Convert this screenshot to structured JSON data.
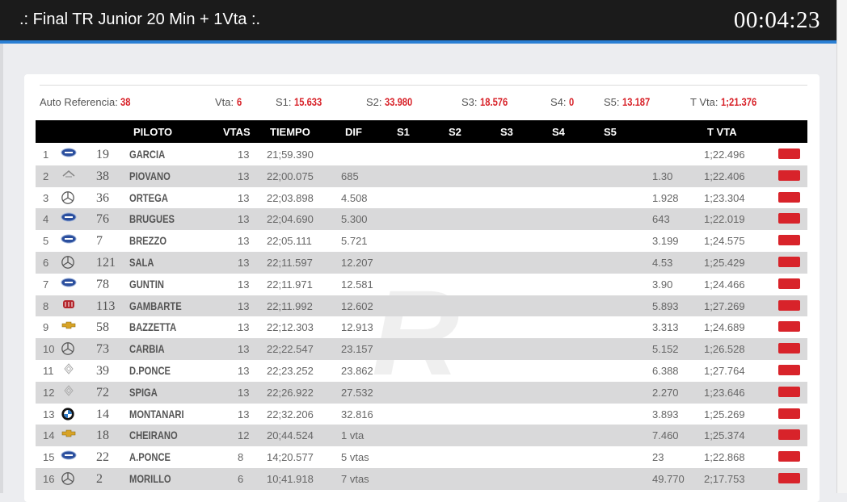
{
  "header": {
    "title": ".: Final TR Junior 20 Min + 1Vta :.",
    "clock": "00:04:23"
  },
  "refs": {
    "auto_label": "Auto Referencia:",
    "auto_value": "38",
    "vta_label": "Vta:",
    "vta_value": "6",
    "s1_label": "S1:",
    "s1_value": "15.633",
    "s2_label": "S2:",
    "s2_value": "33.980",
    "s3_label": "S3:",
    "s3_value": "18.576",
    "s4_label": "S4:",
    "s4_value": "0",
    "s5_label": "S5:",
    "s5_value": "13.187",
    "tvta_label": "T Vta:",
    "tvta_value": "1;21.376"
  },
  "table": {
    "headers": {
      "piloto": "PILOTO",
      "vtas": "VTAS",
      "tiempo": "TIEMPO",
      "dif": "DIF",
      "s1": "S1",
      "s2": "S2",
      "s3": "S3",
      "s4": "S4",
      "s5": "S5",
      "tvta": "T VTA"
    },
    "rows": [
      {
        "pos": "1",
        "brand": "ford",
        "num": "19",
        "name": "GARCIA",
        "vtas": "13",
        "tiempo": "21;59.390",
        "dif": "",
        "s5": "",
        "tvta": "1;22.496"
      },
      {
        "pos": "2",
        "brand": "fiat",
        "num": "38",
        "name": "PIOVANO",
        "vtas": "13",
        "tiempo": "22;00.075",
        "dif": "685",
        "s5": "1.30",
        "tvta": "1;22.406"
      },
      {
        "pos": "3",
        "brand": "mercedes",
        "num": "36",
        "name": "ORTEGA",
        "vtas": "13",
        "tiempo": "22;03.898",
        "dif": "4.508",
        "s5": "1.928",
        "tvta": "1;23.304"
      },
      {
        "pos": "4",
        "brand": "ford",
        "num": "76",
        "name": "BRUGUES",
        "vtas": "13",
        "tiempo": "22;04.690",
        "dif": "5.300",
        "s5": "643",
        "tvta": "1;22.019"
      },
      {
        "pos": "5",
        "brand": "ford",
        "num": "7",
        "name": "BREZZO",
        "vtas": "13",
        "tiempo": "22;05.111",
        "dif": "5.721",
        "s5": "3.199",
        "tvta": "1;24.575"
      },
      {
        "pos": "6",
        "brand": "mercedes",
        "num": "121",
        "name": "SALA",
        "vtas": "13",
        "tiempo": "22;11.597",
        "dif": "12.207",
        "s5": "4.53",
        "tvta": "1;25.429"
      },
      {
        "pos": "7",
        "brand": "ford",
        "num": "78",
        "name": "GUNTIN",
        "vtas": "13",
        "tiempo": "22;11.971",
        "dif": "12.581",
        "s5": "3.90",
        "tvta": "1;24.466"
      },
      {
        "pos": "8",
        "brand": "fiat-red",
        "num": "113",
        "name": "GAMBARTE",
        "vtas": "13",
        "tiempo": "22;11.992",
        "dif": "12.602",
        "s5": "5.893",
        "tvta": "1;27.269"
      },
      {
        "pos": "9",
        "brand": "chevrolet",
        "num": "58",
        "name": "BAZZETTA",
        "vtas": "13",
        "tiempo": "22;12.303",
        "dif": "12.913",
        "s5": "3.313",
        "tvta": "1;24.689"
      },
      {
        "pos": "10",
        "brand": "mercedes",
        "num": "73",
        "name": "CARBIA",
        "vtas": "13",
        "tiempo": "22;22.547",
        "dif": "23.157",
        "s5": "5.152",
        "tvta": "1;26.528"
      },
      {
        "pos": "11",
        "brand": "renault",
        "num": "39",
        "name": "D.PONCE",
        "vtas": "13",
        "tiempo": "22;23.252",
        "dif": "23.862",
        "s5": "6.388",
        "tvta": "1;27.764"
      },
      {
        "pos": "12",
        "brand": "renault",
        "num": "72",
        "name": "SPIGA",
        "vtas": "13",
        "tiempo": "22;26.922",
        "dif": "27.532",
        "s5": "2.270",
        "tvta": "1;23.646"
      },
      {
        "pos": "13",
        "brand": "bmw",
        "num": "14",
        "name": "MONTANARI",
        "vtas": "13",
        "tiempo": "22;32.206",
        "dif": "32.816",
        "s5": "3.893",
        "tvta": "1;25.269"
      },
      {
        "pos": "14",
        "brand": "chevrolet",
        "num": "18",
        "name": "CHEIRANO",
        "vtas": "12",
        "tiempo": "20;44.524",
        "dif": "1 vta",
        "s5": "7.460",
        "tvta": "1;25.374"
      },
      {
        "pos": "15",
        "brand": "ford",
        "num": "22",
        "name": "A.PONCE",
        "vtas": "8",
        "tiempo": "14;20.577",
        "dif": "5 vtas",
        "s5": "23",
        "tvta": "1;22.868"
      },
      {
        "pos": "16",
        "brand": "mercedes",
        "num": "2",
        "name": "MORILLO",
        "vtas": "6",
        "tiempo": "10;41.918",
        "dif": "7 vtas",
        "s5": "49.770",
        "tvta": "2;17.753"
      }
    ]
  },
  "colors": {
    "accent": "#2a7fd4",
    "value_red": "#d8232a",
    "header_bg": "#1b1b1b",
    "row_alt": "#d9d9da"
  }
}
